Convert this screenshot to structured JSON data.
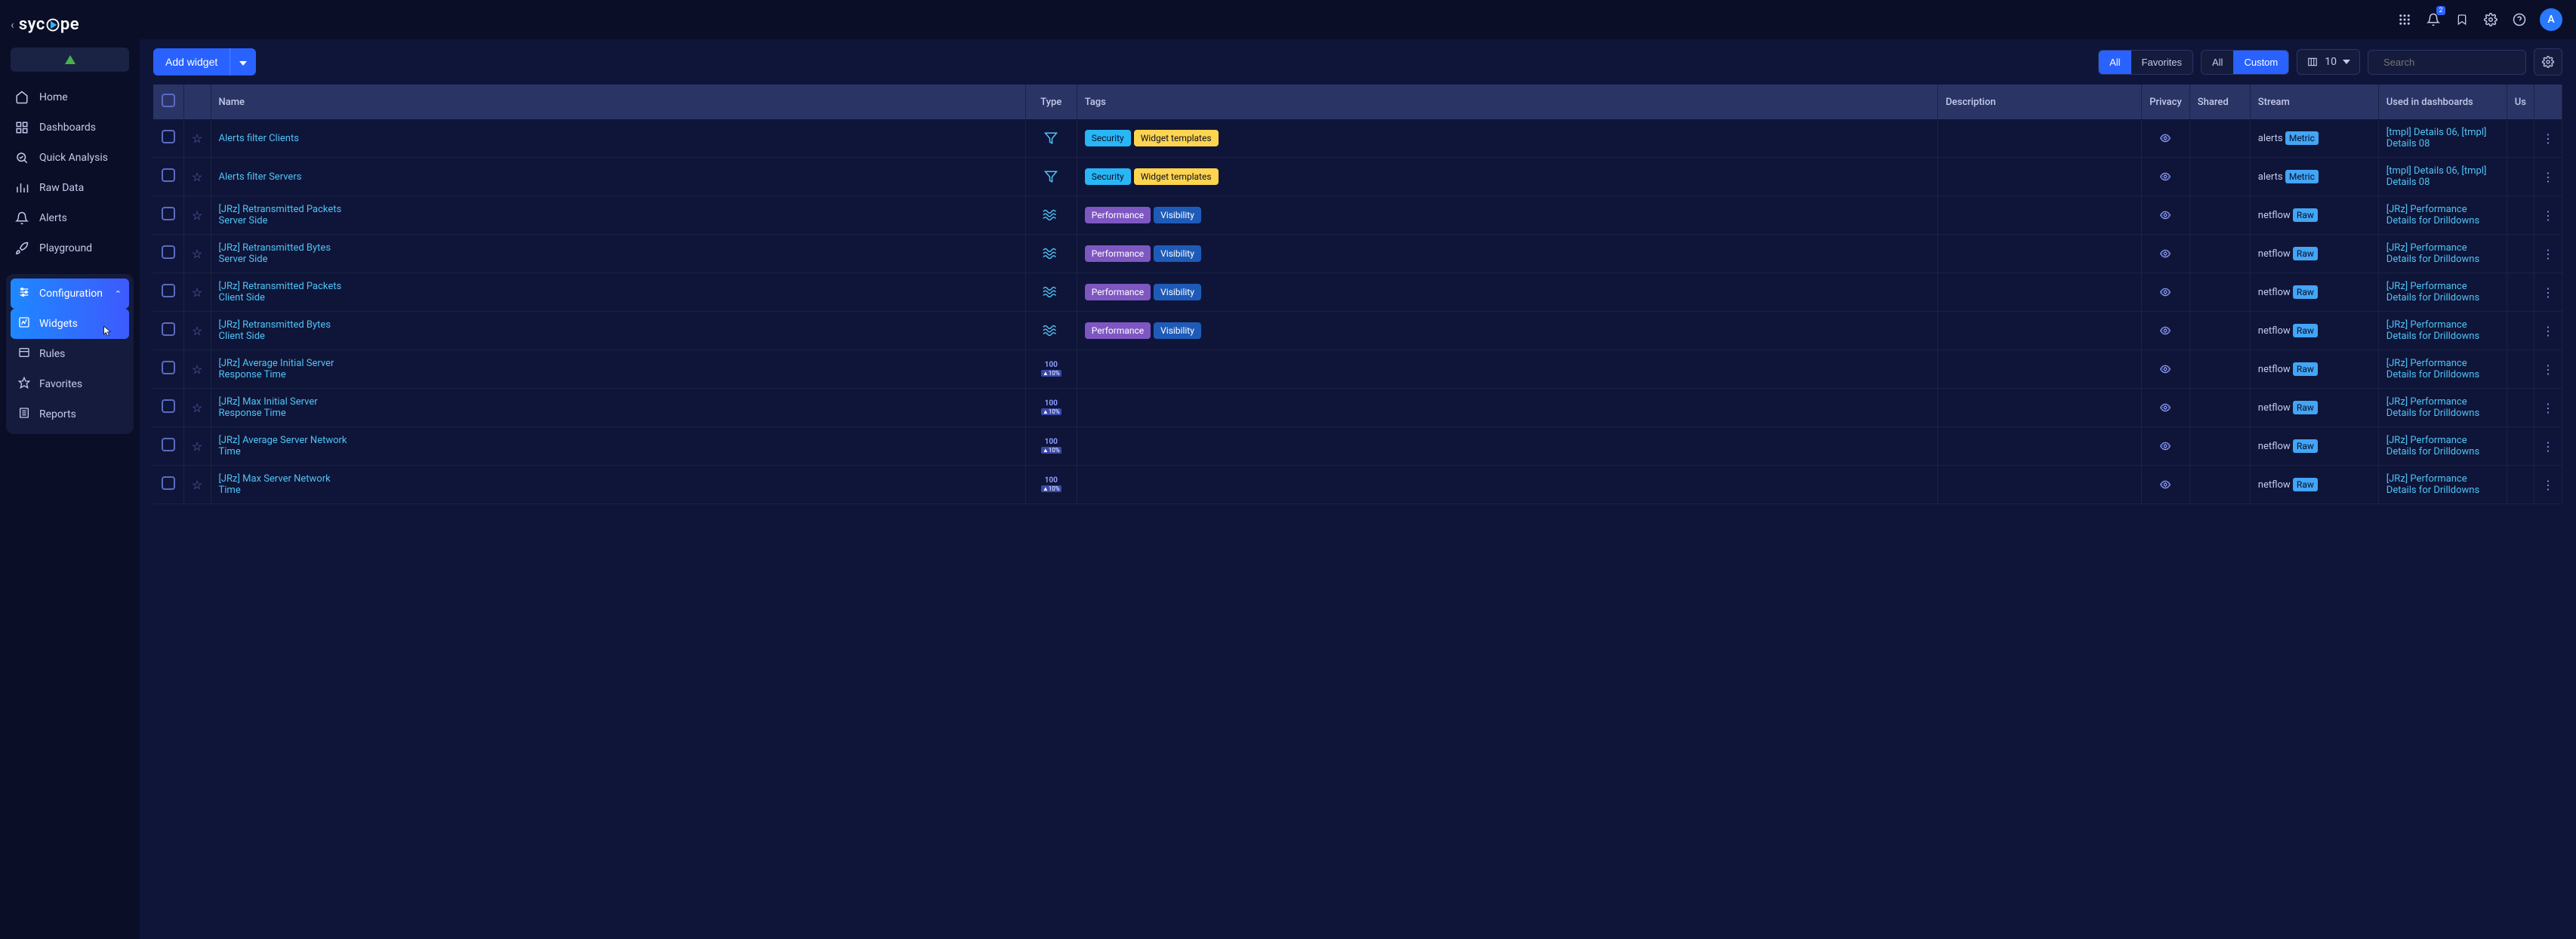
{
  "brand": "sycope",
  "avatar_letter": "A",
  "notification_count": "2",
  "nav": {
    "home": "Home",
    "dashboards": "Dashboards",
    "quick": "Quick Analysis",
    "raw": "Raw Data",
    "alerts": "Alerts",
    "playground": "Playground"
  },
  "subnav": {
    "configuration": "Configuration",
    "widgets": "Widgets",
    "rules": "Rules",
    "favorites": "Favorites",
    "reports": "Reports"
  },
  "toolbar": {
    "add_widget": "Add widget",
    "filter1_all": "All",
    "filter1_fav": "Favorites",
    "filter2_all": "All",
    "filter2_custom": "Custom",
    "cols_count": "10",
    "search_placeholder": "Search"
  },
  "columns": {
    "name": "Name",
    "type": "Type",
    "tags": "Tags",
    "description": "Description",
    "privacy": "Privacy",
    "shared": "Shared",
    "stream": "Stream",
    "used": "Used in dashboards",
    "us": "Us"
  },
  "rows": [
    {
      "name": "Alerts filter Clients",
      "type_icon": "filter",
      "tags": [
        {
          "t": "Security",
          "c": "security"
        },
        {
          "t": "Widget templates",
          "c": "widget"
        }
      ],
      "stream_prefix": "alerts ",
      "stream_badge": "Metric",
      "used": "[tmpl] Details 06, [tmpl] Details 08"
    },
    {
      "name": "Alerts filter Servers",
      "type_icon": "filter",
      "tags": [
        {
          "t": "Security",
          "c": "security"
        },
        {
          "t": "Widget templates",
          "c": "widget"
        }
      ],
      "stream_prefix": "alerts ",
      "stream_badge": "Metric",
      "used": "[tmpl] Details 06, [tmpl] Details 08"
    },
    {
      "name": "[JRz] Retransmitted Packets Server Side",
      "type_icon": "wave",
      "tags": [
        {
          "t": "Performance",
          "c": "perf"
        },
        {
          "t": "Visibility",
          "c": "vis"
        }
      ],
      "stream_prefix": "netflow ",
      "stream_badge": "Raw",
      "used": "[JRz] Performance Details for Drilldowns"
    },
    {
      "name": "[JRz] Retransmitted Bytes Server Side",
      "type_icon": "wave",
      "tags": [
        {
          "t": "Performance",
          "c": "perf"
        },
        {
          "t": "Visibility",
          "c": "vis"
        }
      ],
      "stream_prefix": "netflow ",
      "stream_badge": "Raw",
      "used": "[JRz] Performance Details for Drilldowns"
    },
    {
      "name": "[JRz] Retransmitted Packets Client Side",
      "type_icon": "wave",
      "tags": [
        {
          "t": "Performance",
          "c": "perf"
        },
        {
          "t": "Visibility",
          "c": "vis"
        }
      ],
      "stream_prefix": "netflow ",
      "stream_badge": "Raw",
      "used": "[JRz] Performance Details for Drilldowns"
    },
    {
      "name": "[JRz] Retransmitted Bytes Client Side",
      "type_icon": "wave",
      "tags": [
        {
          "t": "Performance",
          "c": "perf"
        },
        {
          "t": "Visibility",
          "c": "vis"
        }
      ],
      "stream_prefix": "netflow ",
      "stream_badge": "Raw",
      "used": "[JRz] Performance Details for Drilldowns"
    },
    {
      "name": "[JRz] Average Initial Server Response Time",
      "type_icon": "kpi",
      "tags": [],
      "stream_prefix": "netflow ",
      "stream_badge": "Raw",
      "used": "[JRz] Performance Details for Drilldowns"
    },
    {
      "name": "[JRz] Max Initial Server Response Time",
      "type_icon": "kpi",
      "tags": [],
      "stream_prefix": "netflow ",
      "stream_badge": "Raw",
      "used": "[JRz] Performance Details for Drilldowns"
    },
    {
      "name": "[JRz] Average Server Network Time",
      "type_icon": "kpi",
      "tags": [],
      "stream_prefix": "netflow ",
      "stream_badge": "Raw",
      "used": "[JRz] Performance Details for Drilldowns"
    },
    {
      "name": "[JRz] Max Server Network Time",
      "type_icon": "kpi",
      "tags": [],
      "stream_prefix": "netflow ",
      "stream_badge": "Raw",
      "used": "[JRz] Performance Details for Drilldowns"
    }
  ]
}
